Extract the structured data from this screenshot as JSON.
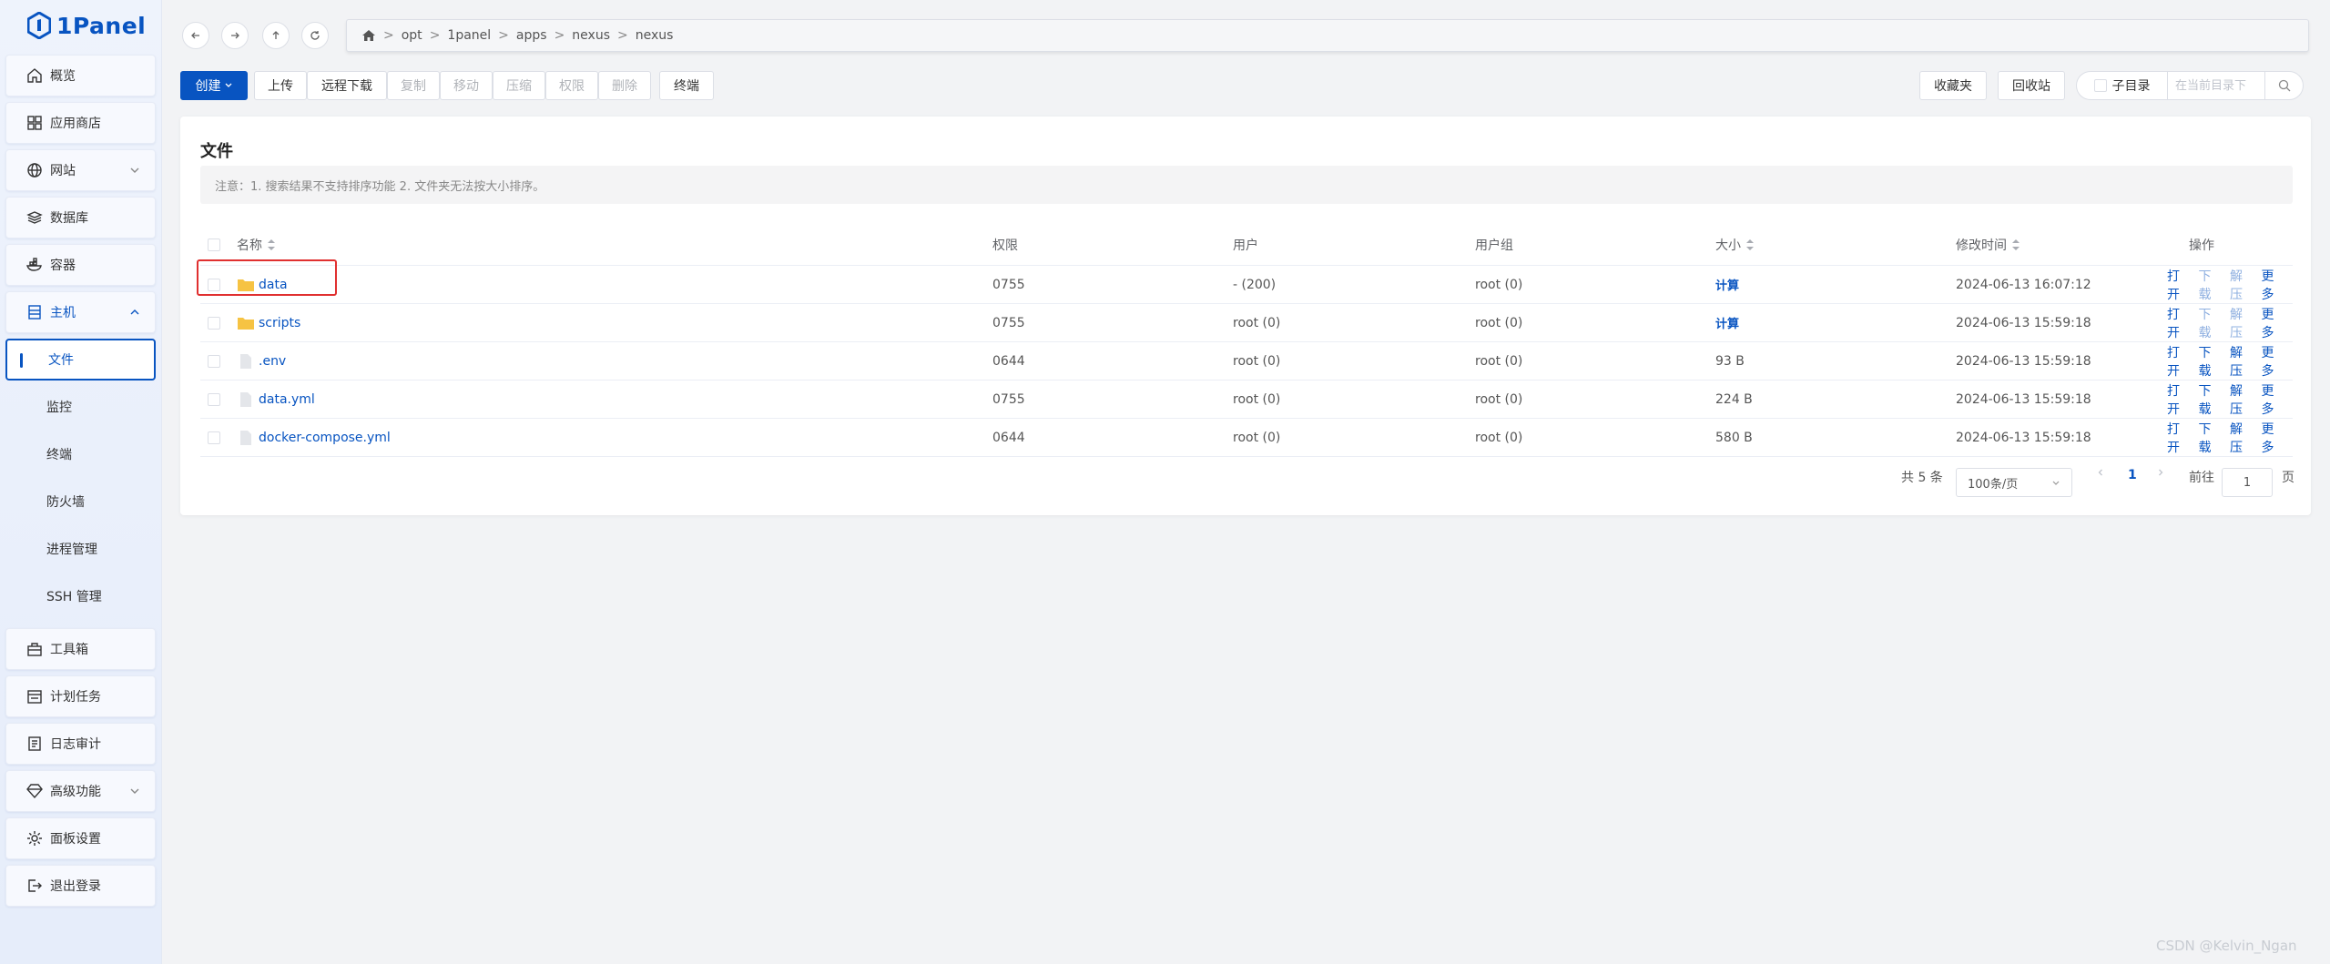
{
  "app": {
    "logo_text": "1Panel"
  },
  "sidebar": {
    "items": [
      {
        "label": "概览",
        "icon": "home-icon"
      },
      {
        "label": "应用商店",
        "icon": "grid-icon"
      },
      {
        "label": "网站",
        "icon": "globe-icon"
      },
      {
        "label": "数据库",
        "icon": "database-icon"
      },
      {
        "label": "容器",
        "icon": "container-icon"
      },
      {
        "label": "主机",
        "icon": "host-icon"
      },
      {
        "label": "工具箱",
        "icon": "toolbox-icon"
      },
      {
        "label": "计划任务",
        "icon": "calendar-icon"
      },
      {
        "label": "日志审计",
        "icon": "log-icon"
      },
      {
        "label": "高级功能",
        "icon": "diamond-icon"
      },
      {
        "label": "面板设置",
        "icon": "gear-icon"
      },
      {
        "label": "退出登录",
        "icon": "logout-icon"
      }
    ],
    "host_sub": [
      "文件",
      "监控",
      "终端",
      "防火墙",
      "进程管理",
      "SSH 管理"
    ]
  },
  "breadcrumb": [
    "opt",
    "1panel",
    "apps",
    "nexus",
    "nexus"
  ],
  "toolbar": {
    "create": "创建",
    "upload": "上传",
    "remote_download": "远程下载",
    "copy": "复制",
    "move": "移动",
    "compress": "压缩",
    "permission": "权限",
    "delete": "删除",
    "terminal": "终端",
    "favorites": "收藏夹",
    "recycle": "回收站",
    "subdir": "子目录",
    "search_placeholder": "在当前目录下"
  },
  "card": {
    "title": "文件",
    "notice": "注意：1. 搜索结果不支持排序功能 2. 文件夹无法按大小排序。"
  },
  "table": {
    "headers": {
      "name": "名称",
      "perm": "权限",
      "user": "用户",
      "group": "用户组",
      "size": "大小",
      "mtime": "修改时间",
      "ops": "操作"
    },
    "rows": [
      {
        "name": "data",
        "type": "folder",
        "perm": "0755",
        "user": "- (200)",
        "group": "root (0)",
        "size": "计算",
        "mtime": "2024-06-13 16:07:12"
      },
      {
        "name": "scripts",
        "type": "folder",
        "perm": "0755",
        "user": "root (0)",
        "group": "root (0)",
        "size": "计算",
        "mtime": "2024-06-13 15:59:18"
      },
      {
        "name": ".env",
        "type": "file",
        "perm": "0644",
        "user": "root (0)",
        "group": "root (0)",
        "size": "93 B",
        "mtime": "2024-06-13 15:59:18"
      },
      {
        "name": "data.yml",
        "type": "file",
        "perm": "0755",
        "user": "root (0)",
        "group": "root (0)",
        "size": "224 B",
        "mtime": "2024-06-13 15:59:18"
      },
      {
        "name": "docker-compose.yml",
        "type": "file",
        "perm": "0644",
        "user": "root (0)",
        "group": "root (0)",
        "size": "580 B",
        "mtime": "2024-06-13 15:59:18"
      }
    ],
    "ops": {
      "open": "打开",
      "download": "下载",
      "decompress": "解压",
      "more": "更多"
    }
  },
  "pagination": {
    "total": "共 5 条",
    "page_size": "100条/页",
    "current": "1",
    "goto": "前往",
    "goto_value": "1",
    "page_unit": "页"
  },
  "watermark": "CSDN @Kelvin_Ngan"
}
